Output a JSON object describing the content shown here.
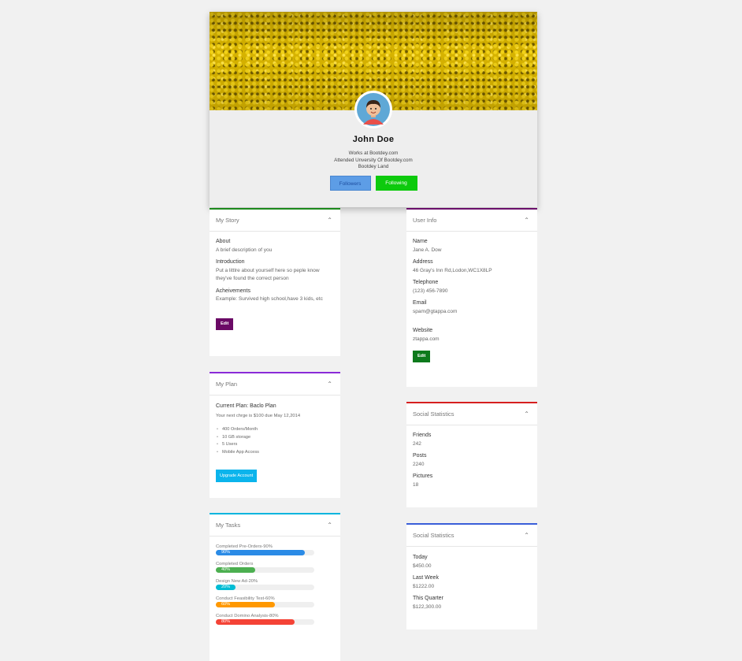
{
  "profile": {
    "name": "John Doe",
    "lines": [
      "Works at Bootdey.com",
      "Attended Unversity Of Bootdey.com",
      "Bootdey Land"
    ],
    "followers_label": "Followers",
    "following_label": "Following"
  },
  "story": {
    "title": "My Story",
    "items": [
      {
        "label": "About",
        "value": "A brief description of you"
      },
      {
        "label": "Introduction",
        "value": "Put a littlre about yourself here so peple know they've found the correct person"
      },
      {
        "label": "Acheivements",
        "value": "Example: Survived high school,have 3 kids, etc"
      }
    ],
    "edit_label": "Edit",
    "accent": "#1d8a1d"
  },
  "plan": {
    "title": "My Plan",
    "current": "Current Plan: Baclo Plan",
    "next": "Your next chrge is $100 due May 12,2014",
    "features": [
      "400 Orders/Month",
      "10 GB storage",
      "5 Users",
      "Mobile App Access"
    ],
    "upgrade_label": "Upgrade Account",
    "accent": "#8a2bd8"
  },
  "tasks": {
    "title": "My Tasks",
    "accent": "#00b5de",
    "items": [
      {
        "label": "Completed Pre-Orders-90%",
        "percent": 90,
        "text": "90%",
        "color": "#2b8be6"
      },
      {
        "label": "Completed Orders",
        "percent": 40,
        "text": "40%",
        "color": "#4caf50"
      },
      {
        "label": "Design New Ad-20%",
        "percent": 20,
        "text": "20%",
        "color": "#00bcd4"
      },
      {
        "label": "Conduct Feasibility Test-60%",
        "percent": 60,
        "text": "60%",
        "color": "#ff9800"
      },
      {
        "label": "Conduct Domino Analysis-80%",
        "percent": 80,
        "text": "80%",
        "color": "#f44336"
      }
    ]
  },
  "user_info": {
    "title": "User Info",
    "accent": "#6b0f6b",
    "items": [
      {
        "label": "Name",
        "value": "Jane A. Dow"
      },
      {
        "label": "Address",
        "value": "46 Gray's Inn Rd,Lodon,WC1X8LP"
      },
      {
        "label": "Telephone",
        "value": "(123) 456-7890"
      },
      {
        "label": "Email",
        "value": "spam@gtappa.com"
      },
      {
        "label": "Website",
        "value": "ztappa.com"
      }
    ],
    "edit_label": "Edit"
  },
  "social_stats": {
    "title": "Social Statistics",
    "accent": "#d61f1f",
    "items": [
      {
        "label": "Friends",
        "value": "242"
      },
      {
        "label": "Posts",
        "value": "2240"
      },
      {
        "label": "Pictures",
        "value": "18"
      }
    ]
  },
  "social_stats2": {
    "title": "Social Statistics",
    "accent": "#3a5fd8",
    "items": [
      {
        "label": "Today",
        "value": "$450.00"
      },
      {
        "label": "Last Week",
        "value": "$1222.00"
      },
      {
        "label": "This Quarter",
        "value": "$122,300.00"
      }
    ]
  },
  "icons": {
    "collapse": "chevron-up-icon"
  }
}
